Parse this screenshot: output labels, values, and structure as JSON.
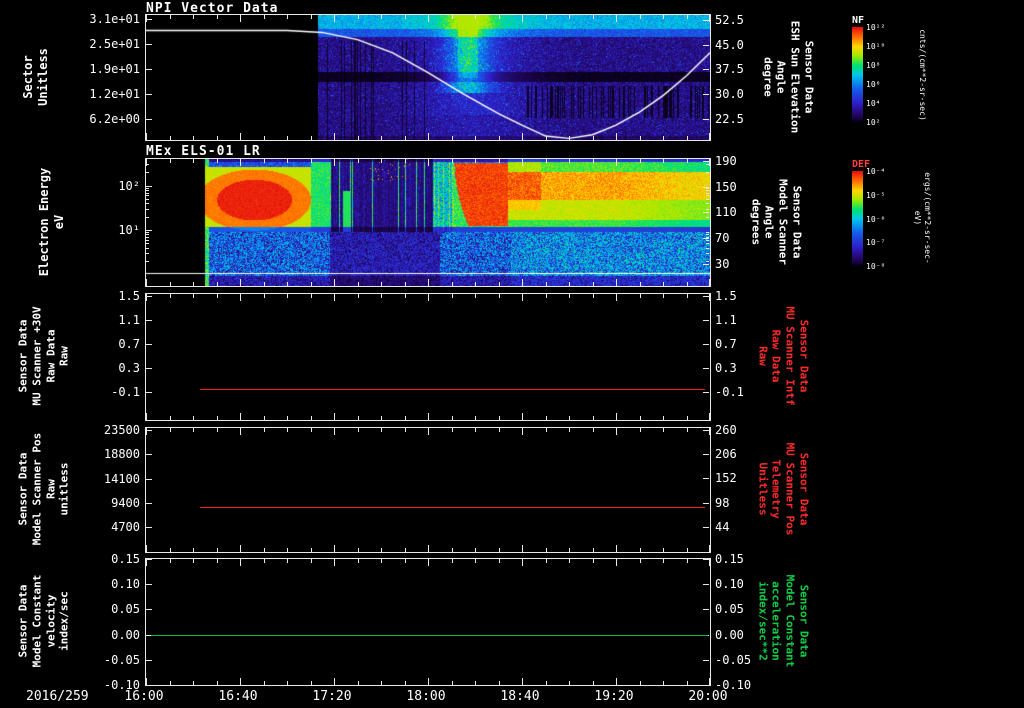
{
  "page": {
    "background": "#000000"
  },
  "xaxis": {
    "date_label": "2016/259",
    "tick_labels": [
      "16:00",
      "16:40",
      "17:20",
      "18:00",
      "18:40",
      "19:20",
      "20:00"
    ],
    "minutes_span": 240
  },
  "chart_data": [
    {
      "type": "heatmap",
      "title": "NPI Vector Data",
      "left_axis": {
        "label": "Sector\nUnitless",
        "tick_labels": [
          "3.1e+01",
          "2.5e+01",
          "1.9e+01",
          "1.2e+01",
          "6.2e+00"
        ],
        "tick_values": [
          31,
          25,
          19,
          12,
          6.2
        ],
        "tick_fracs": [
          0.03,
          0.23,
          0.43,
          0.63,
          0.83
        ]
      },
      "right_axis": {
        "label": "Sensor Data\nESH Sun Elevation\nAngle\ndegree",
        "tick_labels": [
          "52.5",
          "45.0",
          "37.5",
          "30.0",
          "22.5"
        ],
        "tick_values": [
          52.5,
          45.0,
          37.5,
          30.0,
          22.5
        ],
        "range": [
          54,
          16
        ],
        "color": "#ffffff"
      },
      "colorbar": {
        "title": "NF",
        "units": "cnts/(cm**2-sr-sec)",
        "tick_labels": [
          "10¹²",
          "10¹⁰",
          "10⁸",
          "10⁶",
          "10⁴",
          "10²"
        ]
      },
      "overlay_line": {
        "name": "sun-elevation-curve",
        "color": "#ffffff",
        "points": [
          [
            0,
            49.3
          ],
          [
            60,
            49.3
          ],
          [
            75,
            48.7
          ],
          [
            90,
            46.5
          ],
          [
            105,
            42.5
          ],
          [
            120,
            36.5
          ],
          [
            135,
            30
          ],
          [
            150,
            24
          ],
          [
            160,
            20.5
          ],
          [
            170,
            17.2
          ],
          [
            180,
            16.5
          ],
          [
            190,
            17.6
          ],
          [
            200,
            20.5
          ],
          [
            210,
            24.5
          ],
          [
            220,
            29.5
          ],
          [
            230,
            35.5
          ],
          [
            240,
            42.5
          ]
        ]
      },
      "heatmap": {
        "data_start_min": 73,
        "x_start": "17:13",
        "description": "Sparse purple-blue sector count spectrogram from 17:13 to 20:00; bright cyan column near 18:10-18:25; persistently bright top sectors; dark band mid-panel; black dropouts lower-right."
      }
    },
    {
      "type": "heatmap",
      "title": "MEx ELS-01 LR",
      "left_axis": {
        "label": "Electron Energy\neV",
        "scale": "log",
        "tick_labels": [
          "10²",
          "10¹"
        ],
        "tick_exponents": [
          2,
          1
        ],
        "range_exp": [
          2.6,
          -0.26
        ]
      },
      "right_axis": {
        "label": "Sensor Data\nModel Scanner\nAngle\ndegrees",
        "tick_labels": [
          "190",
          "150",
          "110",
          "70",
          "30"
        ],
        "tick_values": [
          190,
          150,
          110,
          70,
          30
        ],
        "range": [
          193,
          -5
        ],
        "color": "#ffffff"
      },
      "colorbar": {
        "title": "DEF",
        "units": "ergs/(cm**2-sr-sec-eV)",
        "tick_labels": [
          "10⁻⁴",
          "10⁻⁵",
          "10⁻⁶",
          "10⁻⁷",
          "10⁻⁸"
        ]
      },
      "overlay_line": {
        "name": "baseline",
        "color": "#ffffff",
        "constant_frac": 0.9
      },
      "heatmap": {
        "data_start_min": 25,
        "x_start": "16:25",
        "description": "Electron energy-time spectrogram: intense red blob 16:25-17:05 at mid energies; dark patchy interval 17:18-18:00 with green columns; intense red region 18:12-18:33 at high energies with curved edge; yellow-green wash to 20:00; blue/cyan speckle at low energies."
      }
    },
    {
      "type": "line",
      "left_axis": {
        "label": "Sensor Data\nMU Scanner +30V\nRaw Data\nRaw",
        "tick_labels": [
          "1.5",
          "1.1",
          "0.7",
          "0.3",
          "-0.1"
        ],
        "tick_values": [
          1.5,
          1.1,
          0.7,
          0.3,
          -0.1
        ],
        "range": [
          1.53,
          -0.57
        ]
      },
      "right_axis": {
        "label": "Sensor Data\nMU Scanner Intf\nRaw Data\nRaw",
        "tick_labels": [
          "1.5",
          "1.1",
          "0.7",
          "0.3",
          "-0.1"
        ],
        "tick_values": [
          1.5,
          1.1,
          0.7,
          0.3,
          -0.1
        ],
        "range": [
          1.53,
          -0.57
        ],
        "color": "#ff2a2a"
      },
      "series": [
        {
          "name": "MU Scanner +30V Raw",
          "color": "#ff1a1a",
          "value": -0.05,
          "start_min": 23,
          "end_min": 238
        }
      ]
    },
    {
      "type": "line",
      "left_axis": {
        "label": "Sensor Data\nModel Scanner Pos\nRaw\nunitless",
        "tick_labels": [
          "23500",
          "18800",
          "14100",
          "9400",
          "4700"
        ],
        "tick_values": [
          23500,
          18800,
          14100,
          9400,
          4700
        ],
        "range": [
          23900,
          -50
        ]
      },
      "right_axis": {
        "label": "Sensor Data\nMU Scanner Pos\nTelemetry\nUnitless",
        "tick_labels": [
          "260",
          "206",
          "152",
          "98",
          "44"
        ],
        "tick_values": [
          260,
          206,
          152,
          98,
          44
        ],
        "range": [
          264,
          -12
        ],
        "color": "#ff2a2a"
      },
      "series": [
        {
          "name": "Model Scanner Pos Raw",
          "color": "#ff1a1a",
          "value": 8700,
          "start_min": 23,
          "end_min": 238
        }
      ]
    },
    {
      "type": "line",
      "left_axis": {
        "label": "Sensor Data\nModel Constant\nvelocity\nindex/sec",
        "tick_labels": [
          "0.15",
          "0.10",
          "0.05",
          "0.00",
          "-0.05",
          "-0.10"
        ],
        "tick_values": [
          0.15,
          0.1,
          0.05,
          0.0,
          -0.05,
          -0.1
        ],
        "range": [
          0.15,
          -0.1
        ]
      },
      "right_axis": {
        "label": "Sensor Data\nModel Constant\nacceleration\nindex/sec**2",
        "tick_labels": [
          "0.15",
          "0.10",
          "0.05",
          "0.00",
          "-0.05",
          "-0.10"
        ],
        "tick_values": [
          0.15,
          0.1,
          0.05,
          0.0,
          -0.05,
          -0.1
        ],
        "range": [
          0.15,
          -0.1
        ],
        "color": "#10cf45"
      },
      "series": [
        {
          "name": "Model Constant velocity",
          "color": "#00c040",
          "value": 0.0,
          "start_min": 2,
          "end_min": 239
        }
      ]
    }
  ]
}
